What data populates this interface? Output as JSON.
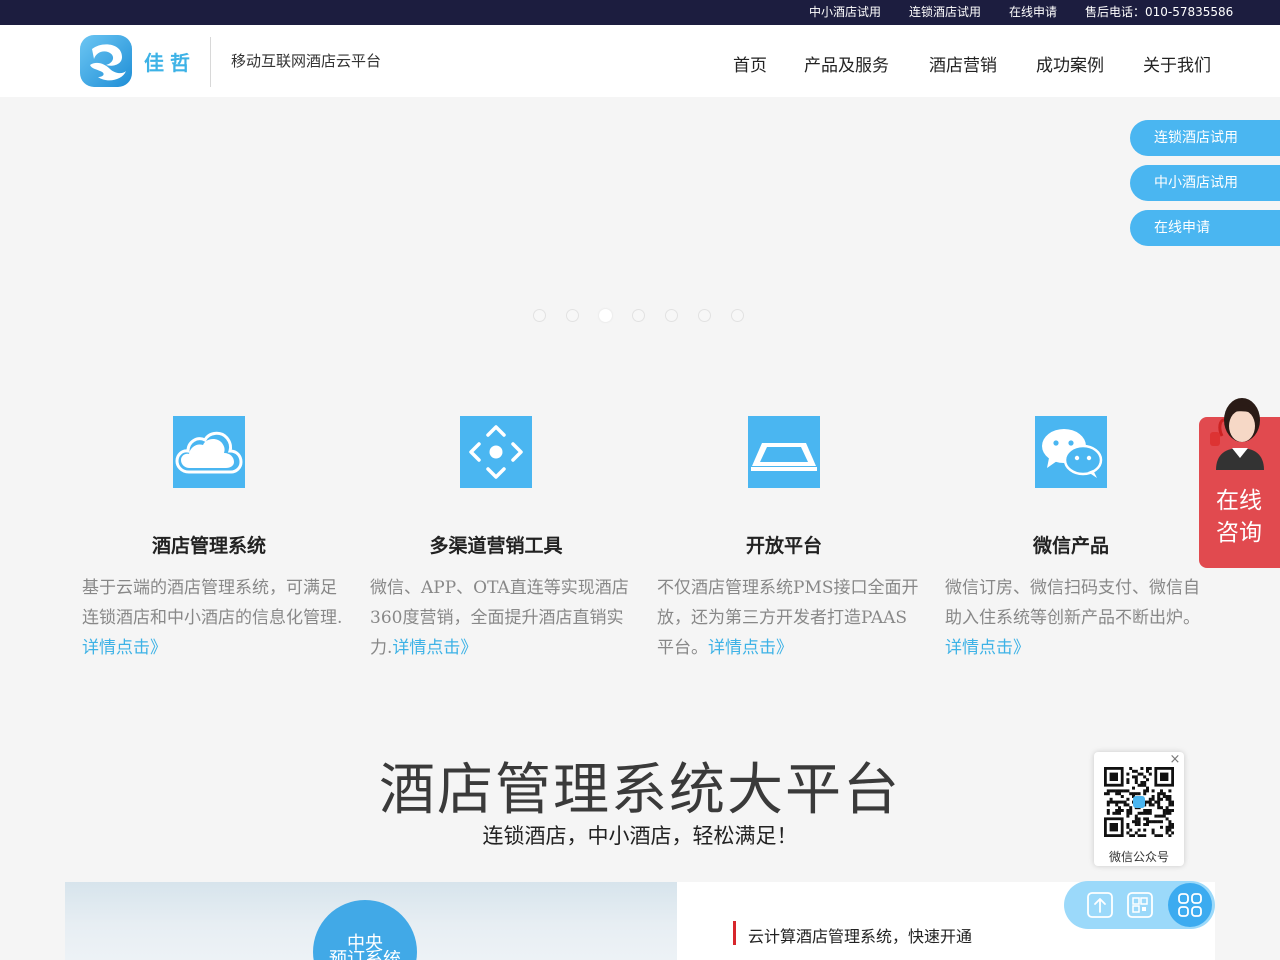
{
  "topbar": {
    "links": [
      {
        "label": "中小酒店试用"
      },
      {
        "label": "连锁酒店试用"
      },
      {
        "label": "在线申请"
      },
      {
        "label": "售后电话：010-57835586"
      }
    ]
  },
  "header": {
    "logo_text": "佳哲",
    "slogan": "移动互联网酒店云平台",
    "nav": [
      {
        "label": "首页"
      },
      {
        "label": "产品及服务"
      },
      {
        "label": "酒店营销"
      },
      {
        "label": "成功案例"
      },
      {
        "label": "关于我们"
      }
    ]
  },
  "banner": {
    "dot_count": 7,
    "active_dot": 3
  },
  "side_pills": [
    {
      "label": "连锁酒店试用"
    },
    {
      "label": "中小酒店试用"
    },
    {
      "label": "在线申请"
    }
  ],
  "features": [
    {
      "icon": "cloud-icon",
      "title": "酒店管理系统",
      "desc": "基于云端的酒店管理系统，可满足连锁酒店和中小酒店的信息化管理.",
      "more": "详情点击》"
    },
    {
      "icon": "arrows-icon",
      "title": "多渠道营销工具",
      "desc": "微信、APP、OTA直连等实现酒店360度营销，全面提升酒店直销实力.",
      "more": "详情点击》"
    },
    {
      "icon": "platform-icon",
      "title": "开放平台",
      "desc": "不仅酒店管理系统PMS接口全面开放，还为第三方开发者打造PAAS平台。",
      "more": "详情点击》"
    },
    {
      "icon": "wechat-icon",
      "title": "微信产品",
      "desc": "微信订房、微信扫码支付、微信自助入住系统等创新产品不断出炉。",
      "more": "详情点击》"
    }
  ],
  "consult": {
    "line1": "在线",
    "line2": "咨询"
  },
  "section": {
    "title": "酒店管理系统大平台",
    "subtitle": "连锁酒店，中小酒店，轻松满足！"
  },
  "bottom": {
    "circle_line1": "中央",
    "circle_line2": "预订系统",
    "right_text": "云计算酒店管理系统，快速开通"
  },
  "qr": {
    "label": "微信公众号",
    "close": "×"
  },
  "colors": {
    "topbar": "#1c1d3f",
    "accent": "#4ab6f1",
    "consult": "#e14a4f",
    "bar_red": "#d7262c"
  }
}
